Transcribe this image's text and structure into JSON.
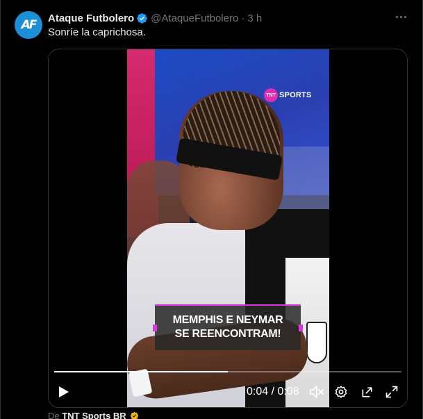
{
  "tweet": {
    "avatar_text": "AF",
    "display_name": "Ataque Futbolero",
    "handle": "@AtaqueFutbolero",
    "separator": "·",
    "time": "3 h",
    "text": "Sonríe la caprichosa.",
    "more_icon": "more-horizontal-icon"
  },
  "video": {
    "watermark": "SPORTS",
    "watermark_logo": "TNT",
    "caption_line1": "MEMPHIS E NEYMAR",
    "caption_line2": "SE REENCONTRAM!",
    "time_display": "0:04 / 0:08",
    "progress_fraction": 0.5,
    "icons": {
      "play": "play-icon",
      "mute": "volume-mute-icon",
      "settings": "gear-icon",
      "popout": "picture-in-picture-icon",
      "fullscreen": "fullscreen-icon"
    }
  },
  "attribution": {
    "prefix": "De",
    "source": "TNT Sports BR"
  },
  "colors": {
    "background": "#000000",
    "text_primary": "#e7e9ea",
    "text_secondary": "#71767b",
    "verified": "#1d9bf0",
    "avatar": "#1d8fd6",
    "caption_accent": "#d63ad6",
    "tnt_pink": "#e22db3",
    "source_badge": "#f4b400"
  }
}
